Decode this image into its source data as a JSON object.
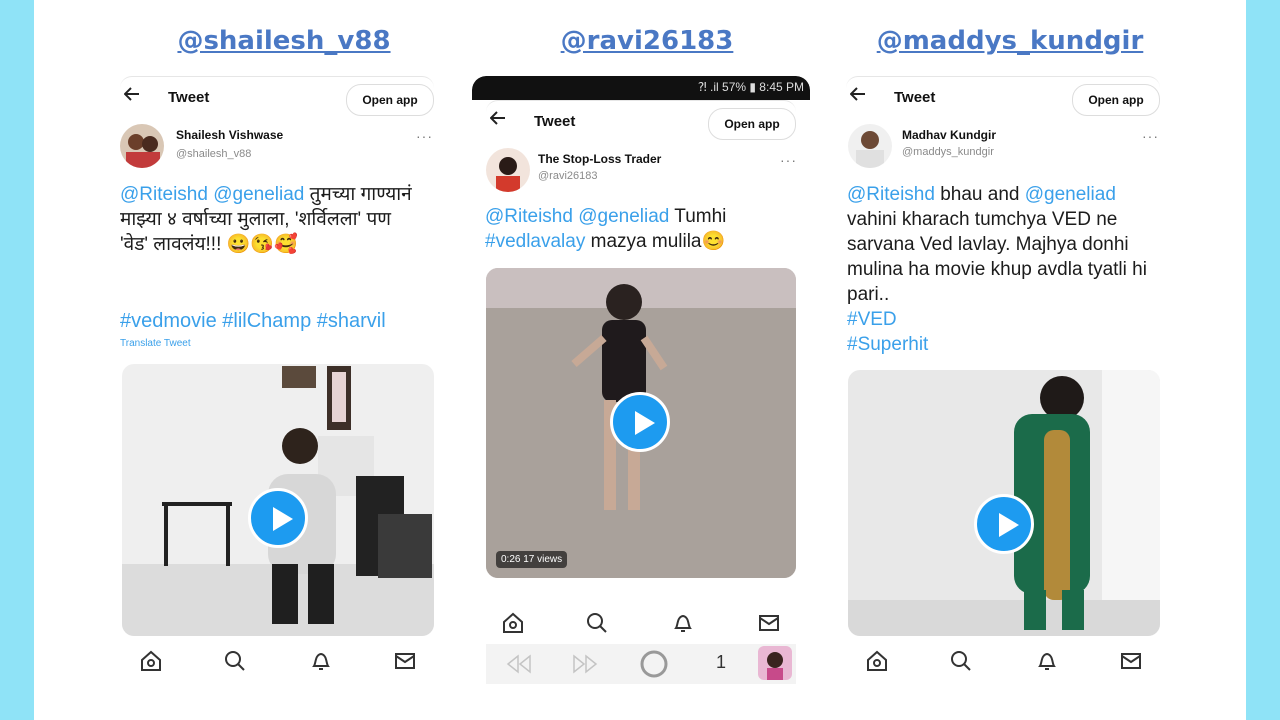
{
  "handles": [
    "@shailesh_v88",
    "@ravi26183",
    "@maddys_kundgir"
  ],
  "topbar": {
    "back_icon": "arrow-left-icon",
    "title": "Tweet",
    "open_app": "Open app"
  },
  "status_bar": {
    "text": "⁈ .il 57% ▮ 8:45 PM"
  },
  "tweets": [
    {
      "name": "Shailesh Vishwase",
      "handle": "@shailesh_v88",
      "mention1": "@Riteishd",
      "mention2": "@geneliad",
      "text_rest": "तुमच्या गाण्यानं माझ्या ४ वर्षाच्या मुलाला, 'शर्विलला' पण 'वेड' लावलंय!!! 😀😘🥰",
      "hashtags": "#vedmovie #lilChamp #sharvil",
      "translate": "Translate Tweet"
    },
    {
      "name": "The Stop-Loss Trader",
      "handle": "@ravi26183",
      "mention1": "@Riteishd",
      "mention2": "@geneliad",
      "text_a": "Tumhi",
      "hashtag": "#vedlavalay",
      "text_b": "mazya mulila😊",
      "video_time": "0:26",
      "video_views": "17 views"
    },
    {
      "name": "Madhav Kundgir",
      "handle": "@maddys_kundgir",
      "mention1": "@Riteishd",
      "mention2": "@geneliad",
      "text_a": "bhau and",
      "text_b": "vahini kharach tumchya VED ne sarvana Ved lavlay. Majhya donhi mulina ha movie khup avdla tyatli hi pari..",
      "tag1": "#VED",
      "tag2": "#Superhit"
    }
  ],
  "page_counter": "1",
  "nav_icons": [
    "home-icon",
    "search-icon",
    "bell-icon",
    "mail-icon"
  ],
  "colors": {
    "background": "#8fe3f7",
    "handle_title": "#4a78c4",
    "link": "#3aa0ea",
    "play_button": "#1d9bf0"
  }
}
